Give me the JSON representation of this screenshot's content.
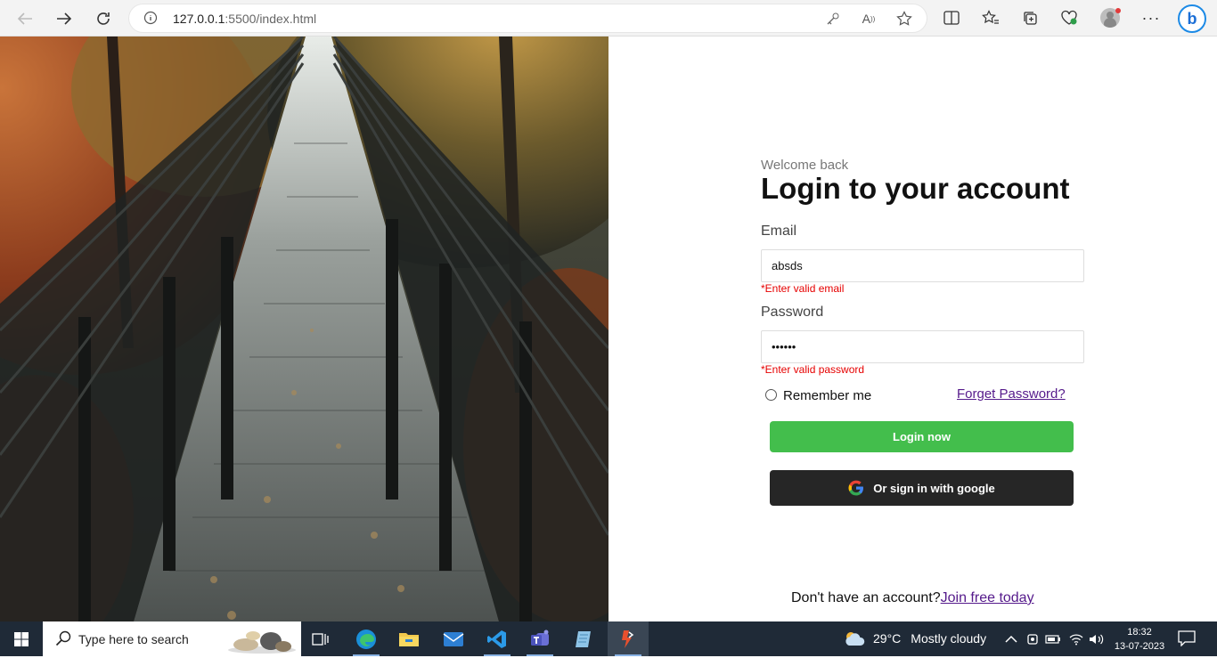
{
  "browser": {
    "url_host": "127.0.0.1",
    "url_rest": ":5500/index.html",
    "icons": [
      "back-icon",
      "forward-icon",
      "refresh-icon",
      "info-icon",
      "key-icon",
      "read-aloud-icon",
      "favorite-star-icon",
      "split-screen-icon",
      "favorites-icon",
      "collections-icon",
      "performance-icon",
      "profile-icon",
      "more-icon",
      "bing-icon"
    ]
  },
  "login": {
    "welcome": "Welcome back",
    "title": "Login to your account",
    "email_label": "Email",
    "email_value": "absds",
    "email_error": "*Enter valid email",
    "password_label": "Password",
    "password_value": "••••••",
    "password_error": "*Enter valid password",
    "remember": "Remember me",
    "forget": "Forget Password?",
    "login_button": "Login now",
    "google_button": "Or sign in with google",
    "no_account": "Don't have an account?",
    "join": "Join free today"
  },
  "colors": {
    "login_green": "#43be4c",
    "google_dark": "#262626",
    "error_red": "#e60000",
    "link_purple": "#551a8b"
  },
  "taskbar": {
    "search_placeholder": "Type here to search",
    "apps": [
      "task-view-icon",
      "edge-icon",
      "file-explorer-icon",
      "mail-icon",
      "vscode-icon",
      "teams-icon",
      "notepad-icon",
      "active-app-icon"
    ],
    "temperature": "29°C",
    "weather": "Mostly cloudy",
    "time": "18:32",
    "date": "13-07-2023"
  }
}
